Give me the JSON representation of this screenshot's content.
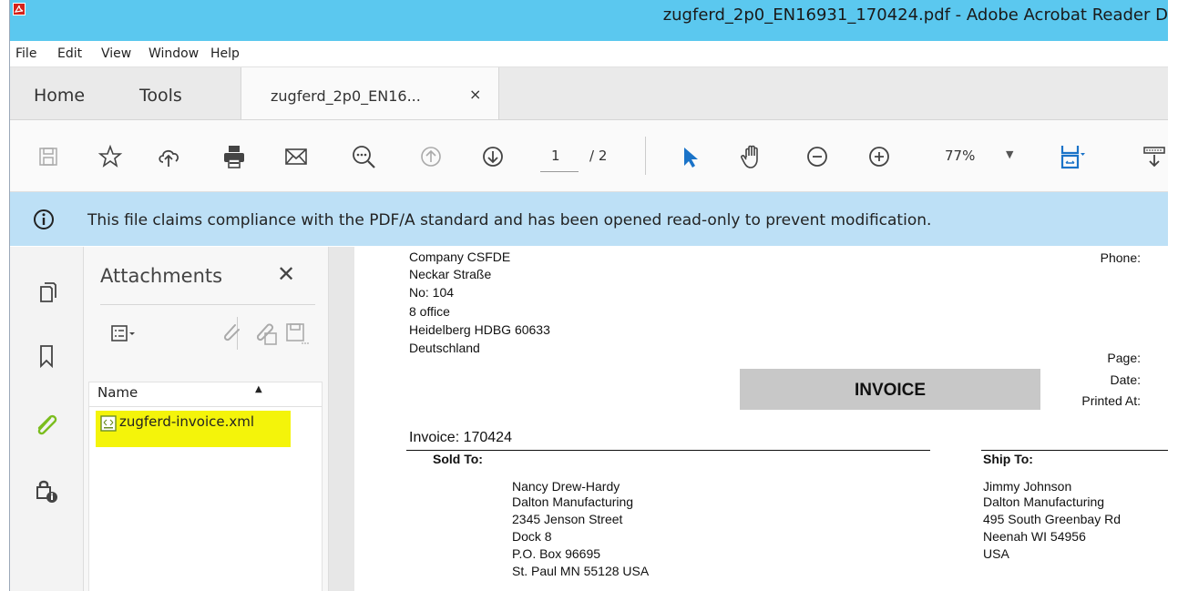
{
  "window": {
    "title": "zugferd_2p0_EN16931_170424.pdf - Adobe Acrobat Reader D"
  },
  "menu": {
    "items": [
      "File",
      "Edit",
      "View",
      "Window",
      "Help"
    ]
  },
  "tabs": {
    "home": "Home",
    "tools": "Tools",
    "document": "zugferd_2p0_EN16...",
    "close": "×"
  },
  "toolbar": {
    "page_current": "1",
    "page_total": "/ 2",
    "zoom": "77%",
    "icons": [
      "save-icon",
      "bookmark-star-icon",
      "cloud-upload-icon",
      "print-icon",
      "mail-icon",
      "search-zoom-icon",
      "page-up-icon",
      "page-down-icon",
      "select-pointer-icon",
      "hand-tool-icon",
      "zoom-out-icon",
      "zoom-in-icon",
      "fit-page-icon",
      "more-tools-icon"
    ]
  },
  "infobar": {
    "message": "This file claims compliance with the PDF/A standard and has been opened read-only to prevent modification."
  },
  "panel": {
    "title": "Attachments",
    "close": "✕",
    "column_name": "Name",
    "files": [
      {
        "name": "zugferd-invoice.xml",
        "highlight": "#f4f40a"
      }
    ]
  },
  "document": {
    "seller": {
      "lines": [
        "Company CSFDE",
        "Neckar Straße",
        "No: 104",
        "8 office",
        "Heidelberg HDBG 60633",
        "Deutschland"
      ]
    },
    "labels": {
      "phone": "Phone:",
      "page": "Page:",
      "date": "Date:",
      "printed_at": "Printed At:"
    },
    "invoice_title": "INVOICE",
    "invoice_number": "Invoice: 170424",
    "sold_to": {
      "label": "Sold To:",
      "lines": [
        "Nancy Drew-Hardy",
        "Dalton Manufacturing",
        "2345 Jenson Street",
        "Dock 8",
        "P.O. Box 96695",
        "St. Paul MN 55128 USA"
      ]
    },
    "ship_to": {
      "label": "Ship To:",
      "lines": [
        "Jimmy Johnson",
        "Dalton Manufacturing",
        "495 South Greenbay Rd",
        "Neenah WI 54956",
        "USA"
      ]
    }
  },
  "colors": {
    "titlebar": "#5bc8ef",
    "infobar": "#bde0f6",
    "accent_blue": "#1a73c8",
    "attachment_green": "#7bbd1e",
    "highlight": "#f4f40a"
  }
}
